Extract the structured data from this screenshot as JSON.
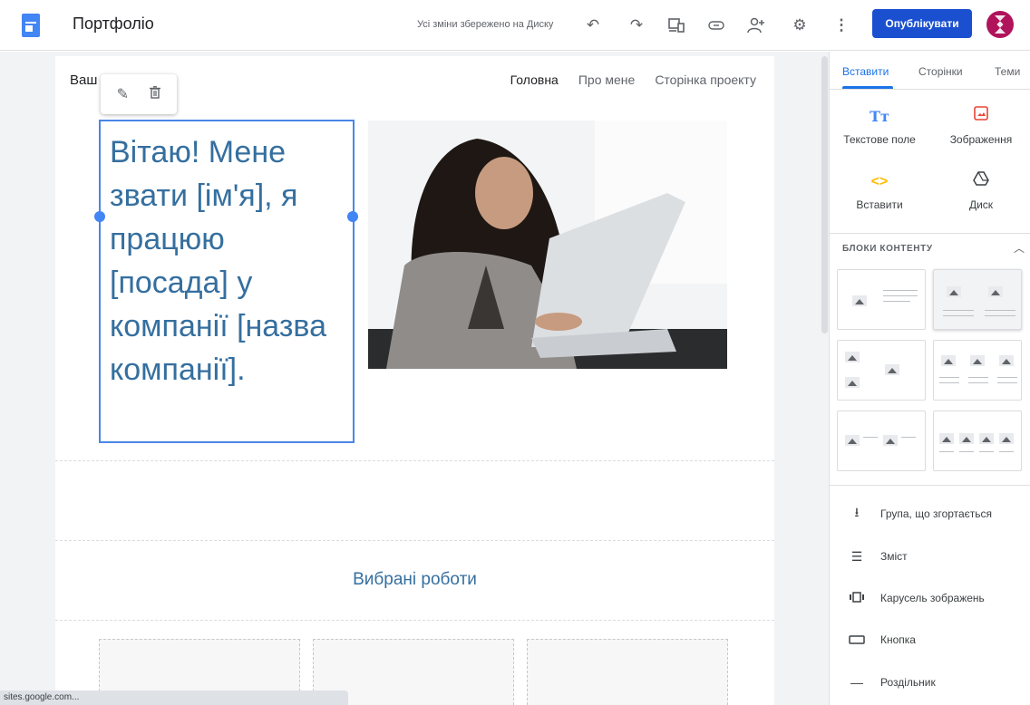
{
  "app": {
    "title": "Портфоліо",
    "save_status": "Усі зміни збережено на Диску",
    "publish_label": "Опублікувати",
    "accent": "#1a4fd0"
  },
  "toolbar_icons": [
    "undo-icon",
    "redo-icon",
    "preview-icon",
    "link-icon",
    "share-icon",
    "settings-icon",
    "more-icon"
  ],
  "site": {
    "name": "Ваш",
    "nav": [
      "Головна",
      "Про мене",
      "Сторінка проекту"
    ],
    "hero_text": "Вітаю! Мене звати [ім'я], я працюю [посада] у компанії [назва компанії].",
    "featured_title": "Вибрані роботи"
  },
  "panel": {
    "tabs": [
      "Вставити",
      "Сторінки",
      "Теми"
    ],
    "insert_items": [
      {
        "label": "Текстове поле",
        "icon": "text-box-icon"
      },
      {
        "label": "Зображення",
        "icon": "image-icon"
      },
      {
        "label": "Вставити",
        "icon": "embed-icon"
      },
      {
        "label": "Диск",
        "icon": "drive-icon"
      }
    ],
    "blocks_title": "БЛОКИ КОНТЕНТУ",
    "list": [
      {
        "label": "Група, що згортається",
        "icon": "collapsible-icon"
      },
      {
        "label": "Зміст",
        "icon": "toc-icon"
      },
      {
        "label": "Карусель зображень",
        "icon": "carousel-icon"
      },
      {
        "label": "Кнопка",
        "icon": "button-icon"
      },
      {
        "label": "Роздільник",
        "icon": "divider-icon"
      }
    ]
  },
  "status_url": "sites.google.com..."
}
